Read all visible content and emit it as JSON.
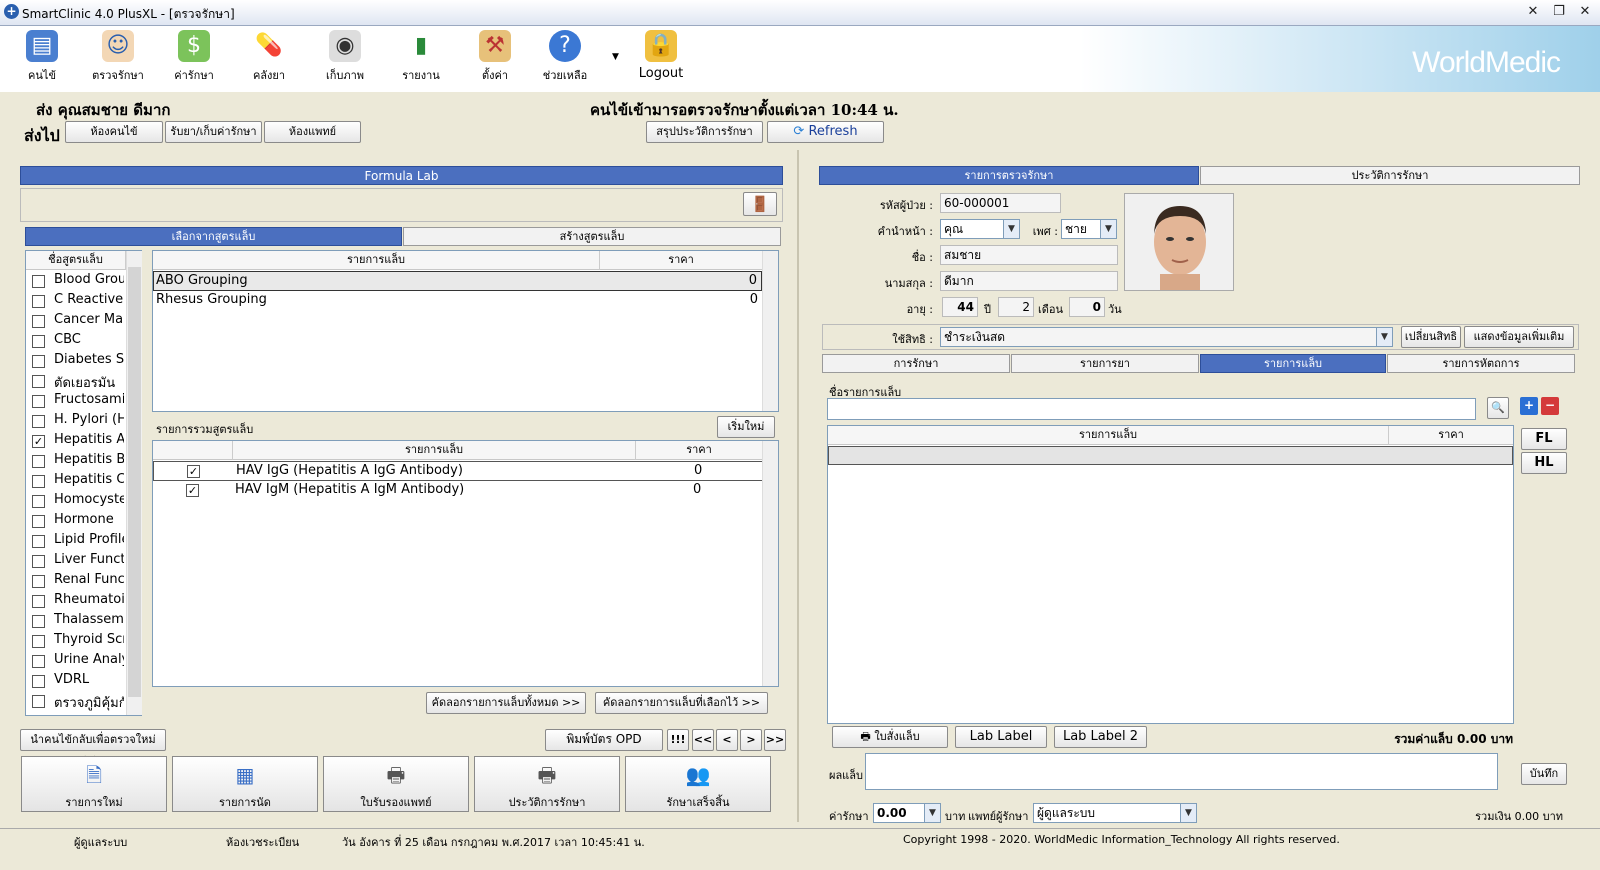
{
  "window": {
    "title": "SmartClinic 4.0 PlusXL - [ตรวจรักษา]"
  },
  "toolbar": {
    "items": [
      {
        "label": "คนไข้",
        "icon": "patient-book-icon"
      },
      {
        "label": "ตรวจรักษา",
        "icon": "doctor-icon"
      },
      {
        "label": "ค่ารักษา",
        "icon": "money-icon"
      },
      {
        "label": "คลังยา",
        "icon": "pill-icon"
      },
      {
        "label": "เก็บภาพ",
        "icon": "camera-icon"
      },
      {
        "label": "รายงาน",
        "icon": "chart-icon"
      },
      {
        "label": "ตั้งค่า",
        "icon": "settings-tools-icon"
      },
      {
        "label": "ช่วยเหลือ",
        "icon": "help-icon"
      },
      {
        "label": "Logout",
        "icon": "lock-icon"
      }
    ],
    "brand": "WorldMedic"
  },
  "header": {
    "patient": "ส่ง  คุณสมชาย ดีมาก",
    "message": "คนไข้เข้ามารอตรวจรักษาตั้งแต่เวลา 10:44 น.",
    "sendto_label": "ส่งไป",
    "btn_patient_room": "ห้องคนไข้",
    "btn_medicine": "รับยา/เก็บค่ารักษา",
    "btn_doctor_room": "ห้องแพทย์",
    "btn_summary": "สรุปประวัติการรักษา",
    "btn_refresh": "Refresh"
  },
  "left": {
    "panel_title": "Formula Lab",
    "tab_choose": "เลือกจากสูตรแล็บ",
    "tab_create": "สร้างสูตรแล็บ",
    "formula_header": "ชื่อสูตรแล็บ",
    "formulas": [
      {
        "name": "Blood Grou",
        "checked": false
      },
      {
        "name": "C Reactive",
        "checked": false
      },
      {
        "name": "Cancer Mar",
        "checked": false
      },
      {
        "name": "CBC",
        "checked": false
      },
      {
        "name": "Diabetes S",
        "checked": false
      },
      {
        "name": "ตัดเยอรมัน",
        "checked": false
      },
      {
        "name": "Fructosami",
        "checked": false
      },
      {
        "name": "H. Pylori (H",
        "checked": false
      },
      {
        "name": "Hepatitis A",
        "checked": true
      },
      {
        "name": "Hepatitis B",
        "checked": false
      },
      {
        "name": "Hepatitis C",
        "checked": false
      },
      {
        "name": "Homocyste",
        "checked": false
      },
      {
        "name": "Hormone",
        "checked": false
      },
      {
        "name": "Lipid Profile",
        "checked": false
      },
      {
        "name": "Liver Functi",
        "checked": false
      },
      {
        "name": "Renal Func",
        "checked": false
      },
      {
        "name": "Rheumatoi",
        "checked": false
      },
      {
        "name": "Thalassem",
        "checked": false
      },
      {
        "name": "Thyroid Scr",
        "checked": false
      },
      {
        "name": "Urine Analy",
        "checked": false
      },
      {
        "name": "VDRL",
        "checked": false
      },
      {
        "name": "ตรวจภูมิคุ้มกัน",
        "checked": false
      }
    ],
    "lab_header_item": "รายการแล็บ",
    "lab_header_price": "ราคา",
    "labs": [
      {
        "name": "ABO Grouping",
        "price": "0"
      },
      {
        "name": "Rhesus Grouping",
        "price": "0"
      }
    ],
    "combined_label": "รายการรวมสูตรแล็บ",
    "btn_restart": "เริ่มใหม่",
    "combined_header_item": "รายการแล็บ",
    "combined_header_price": "ราคา",
    "combined": [
      {
        "name": "HAV IgG (Hepatitis A IgG Antibody)",
        "price": "0",
        "checked": true
      },
      {
        "name": "HAV IgM (Hepatitis A IgM Antibody)",
        "price": "0",
        "checked": true
      }
    ],
    "btn_copy_all": "คัดลอกรายการแล็บทั้งหมด >>",
    "btn_copy_selected": "คัดลอกรายการแล็บที่เลือกไว้ >>",
    "btn_return": "นำคนไข้กลับเพื่อตรวจใหม่ >>",
    "btn_print_opd": "พิมพ์บัตร OPD",
    "nav_alert": "!!!",
    "nav_first": "<<",
    "nav_prev": "<",
    "nav_next": ">",
    "nav_last": ">>",
    "bottom_buttons": [
      {
        "label": "รายการใหม่",
        "icon": "new-document-icon"
      },
      {
        "label": "รายการนัด",
        "icon": "calendar-icon"
      },
      {
        "label": "ใบรับรองแพทย์",
        "icon": "printer-icon"
      },
      {
        "label": "ประวัติการรักษา",
        "icon": "history-printer-icon"
      },
      {
        "label": "รักษาเสร็จสิ้น",
        "icon": "users-check-icon"
      }
    ]
  },
  "right": {
    "tab_exam": "รายการตรวจรักษา",
    "tab_history": "ประวัติการรักษา",
    "hn_label": "รหัสผู้ป่วย :",
    "hn": "60-000001",
    "prefix_label": "คำนำหน้า :",
    "prefix": "คุณ",
    "sex_label": "เพศ :",
    "sex": "ชาย",
    "name_label": "ชื่อ :",
    "name": "สมชาย",
    "surname_label": "นามสกุล :",
    "surname": "ดีมาก",
    "age_label": "อายุ :",
    "age_y": "44",
    "age_y_unit": "ปี",
    "age_m": "2",
    "age_m_unit": "เดือน",
    "age_d": "0",
    "age_d_unit": "วัน",
    "right_label": "ใช้สิทธิ :",
    "right_value": "ชำระเงินสด",
    "btn_change_right": "เปลี่ยนสิทธิ",
    "btn_more_info": "แสดงข้อมูลเพิ่มเติม",
    "subtabs": [
      "การรักษา",
      "รายการยา",
      "รายการแล็บ",
      "รายการหัตถการ"
    ],
    "lab_name_label": "ชื่อรายการแล็บ",
    "grid_item": "รายการแล็บ",
    "grid_price": "ราคา",
    "btn_fl": "FL",
    "btn_hl": "HL",
    "btn_lab_order": "ใบสั่งแล็บ",
    "btn_lab_label": "Lab Label",
    "btn_lab_label2": "Lab Label 2",
    "lab_total": "รวมค่าแล็บ 0.00 บาท",
    "result_label": "ผลแล็บ",
    "btn_save": "บันทึก",
    "fee_label": "ค่ารักษา :",
    "fee": "0.00",
    "fee_unit": "บาท",
    "doctor_label": "แพทย์ผู้รักษา :",
    "doctor": "ผู้ดูแลระบบ",
    "total": "รวมเงิน 0.00 บาท"
  },
  "status": {
    "user": "ผู้ดูแลระบบ",
    "room": "ห้องเวชระเบียน",
    "datetime": "วัน อังคาร ที่ 25 เดือน กรกฎาคม พ.ศ.2017 เวลา 10:45:41 น.",
    "copyright": "Copyright 1998 - 2020. WorldMedic Information_Technology All rights reserved."
  }
}
